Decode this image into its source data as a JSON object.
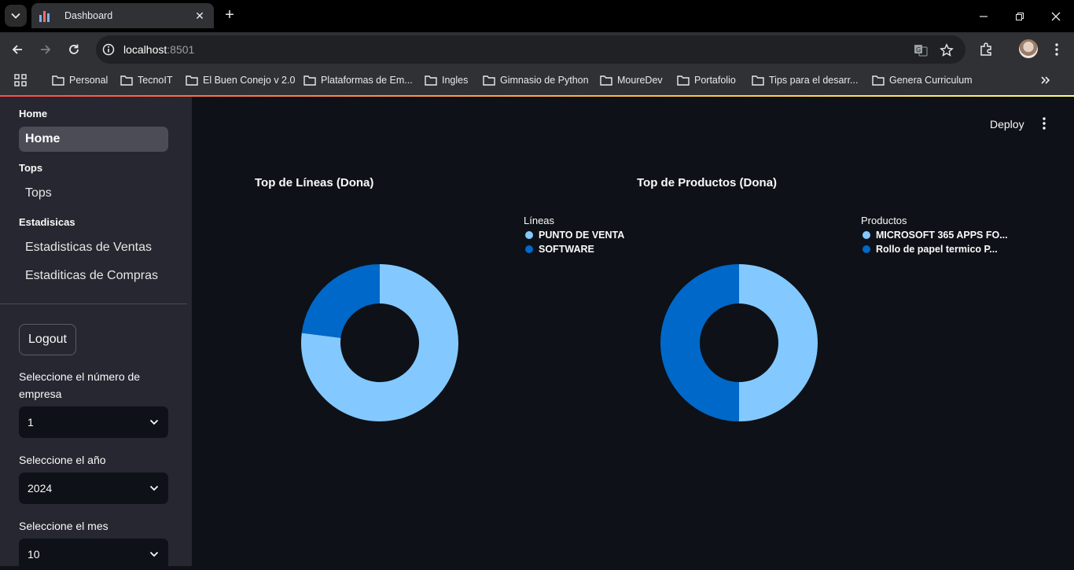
{
  "browser": {
    "tab_title": "Dashboard",
    "url_host": "localhost",
    "url_port": ":8501",
    "bookmarks": [
      "Personal",
      "TecnoIT",
      "El Buen Conejo v 2.0",
      "Plataformas de Em...",
      "Ingles",
      "Gimnasio de Python",
      "MoureDev",
      "Portafolio",
      "Tips para el desarr...",
      "Genera Curriculum"
    ]
  },
  "sidebar": {
    "sections": [
      {
        "title": "Home",
        "items": [
          "Home"
        ]
      },
      {
        "title": "Tops",
        "items": [
          "Tops"
        ]
      },
      {
        "title": "Estadisicas",
        "items": [
          "Estadisticas de Ventas",
          "Estaditicas de Compras"
        ]
      }
    ],
    "logout_label": "Logout",
    "filters": [
      {
        "label": "Seleccione el número de empresa",
        "value": "1"
      },
      {
        "label": "Seleccione el año",
        "value": "2024"
      },
      {
        "label": "Seleccione el mes",
        "value": "10"
      }
    ]
  },
  "header": {
    "deploy_label": "Deploy"
  },
  "colors": {
    "light_blue": "#83c9ff",
    "dark_blue": "#0068c9"
  },
  "chart_data": [
    {
      "type": "pie",
      "title": "Top de Líneas (Dona)",
      "legend_title": "Líneas",
      "categories": [
        "PUNTO DE VENTA",
        "SOFTWARE"
      ],
      "values": [
        77,
        23
      ],
      "colors": [
        "#83c9ff",
        "#0068c9"
      ],
      "hole": 0.5
    },
    {
      "type": "pie",
      "title": "Top de Productos (Dona)",
      "legend_title": "Productos",
      "categories": [
        "MICROSOFT 365 APPS FO...",
        "Rollo de papel termico P..."
      ],
      "values": [
        50,
        50
      ],
      "colors": [
        "#83c9ff",
        "#0068c9"
      ],
      "hole": 0.5
    }
  ]
}
